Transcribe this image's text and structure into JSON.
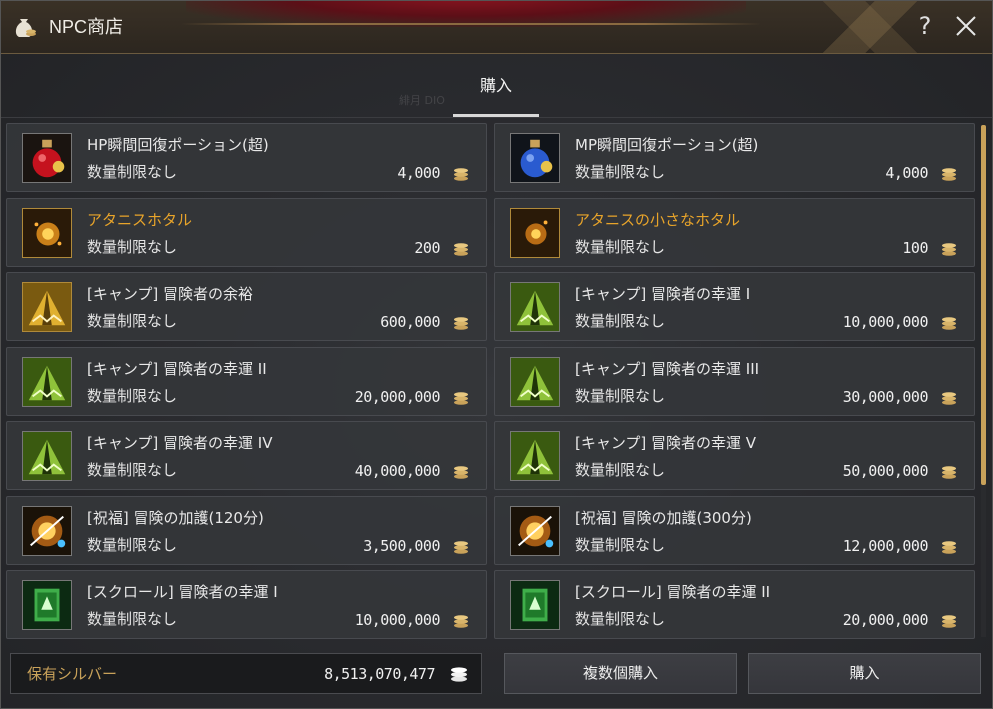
{
  "window": {
    "title": "NPC商店",
    "help_label": "?"
  },
  "tabs": [
    {
      "label": "購入",
      "active": true
    }
  ],
  "ghost_text": "緋月 DIO",
  "items": [
    {
      "name": "HP瞬間回復ポーション(超)",
      "limit": "数量制限なし",
      "price": "4,000",
      "icon": "hp-potion-icon",
      "name_color": "white"
    },
    {
      "name": "MP瞬間回復ポーション(超)",
      "limit": "数量制限なし",
      "price": "4,000",
      "icon": "mp-potion-icon",
      "name_color": "white"
    },
    {
      "name": "アタニスホタル",
      "limit": "数量制限なし",
      "price": "200",
      "icon": "firefly-icon",
      "name_color": "gold"
    },
    {
      "name": "アタニスの小さなホタル",
      "limit": "数量制限なし",
      "price": "100",
      "icon": "small-firefly-icon",
      "name_color": "gold"
    },
    {
      "name": "[キャンプ] 冒険者の余裕",
      "limit": "数量制限なし",
      "price": "600,000",
      "icon": "camp-tent-gold-icon",
      "name_color": "white"
    },
    {
      "name": "[キャンプ] 冒険者の幸運 I",
      "limit": "数量制限なし",
      "price": "10,000,000",
      "icon": "camp-tent-green-icon",
      "name_color": "white"
    },
    {
      "name": "[キャンプ] 冒険者の幸運 II",
      "limit": "数量制限なし",
      "price": "20,000,000",
      "icon": "camp-tent-green-icon",
      "name_color": "white"
    },
    {
      "name": "[キャンプ] 冒険者の幸運 III",
      "limit": "数量制限なし",
      "price": "30,000,000",
      "icon": "camp-tent-green-icon",
      "name_color": "white"
    },
    {
      "name": "[キャンプ] 冒険者の幸運 IV",
      "limit": "数量制限なし",
      "price": "40,000,000",
      "icon": "camp-tent-green-icon",
      "name_color": "white"
    },
    {
      "name": "[キャンプ] 冒険者の幸運 V",
      "limit": "数量制限なし",
      "price": "50,000,000",
      "icon": "camp-tent-green-icon",
      "name_color": "white"
    },
    {
      "name": "[祝福] 冒険の加護(120分)",
      "limit": "数量制限なし",
      "price": "3,500,000",
      "icon": "blessing-icon",
      "name_color": "white"
    },
    {
      "name": "[祝福] 冒険の加護(300分)",
      "limit": "数量制限なし",
      "price": "12,000,000",
      "icon": "blessing-icon",
      "name_color": "white"
    },
    {
      "name": "[スクロール] 冒険者の幸運 I",
      "limit": "数量制限なし",
      "price": "10,000,000",
      "icon": "scroll-icon",
      "name_color": "white"
    },
    {
      "name": "[スクロール] 冒険者の幸運 II",
      "limit": "数量制限なし",
      "price": "20,000,000",
      "icon": "scroll-icon",
      "name_color": "white"
    }
  ],
  "footer": {
    "silver_label": "保有シルバー",
    "silver_value": "8,513,070,477",
    "multi_buy_label": "複数個購入",
    "buy_label": "購入"
  },
  "colors": {
    "gold_text": "#e8a42a",
    "scrollbar": "#c9a25a",
    "panel_bg": "#2a2b2f"
  }
}
